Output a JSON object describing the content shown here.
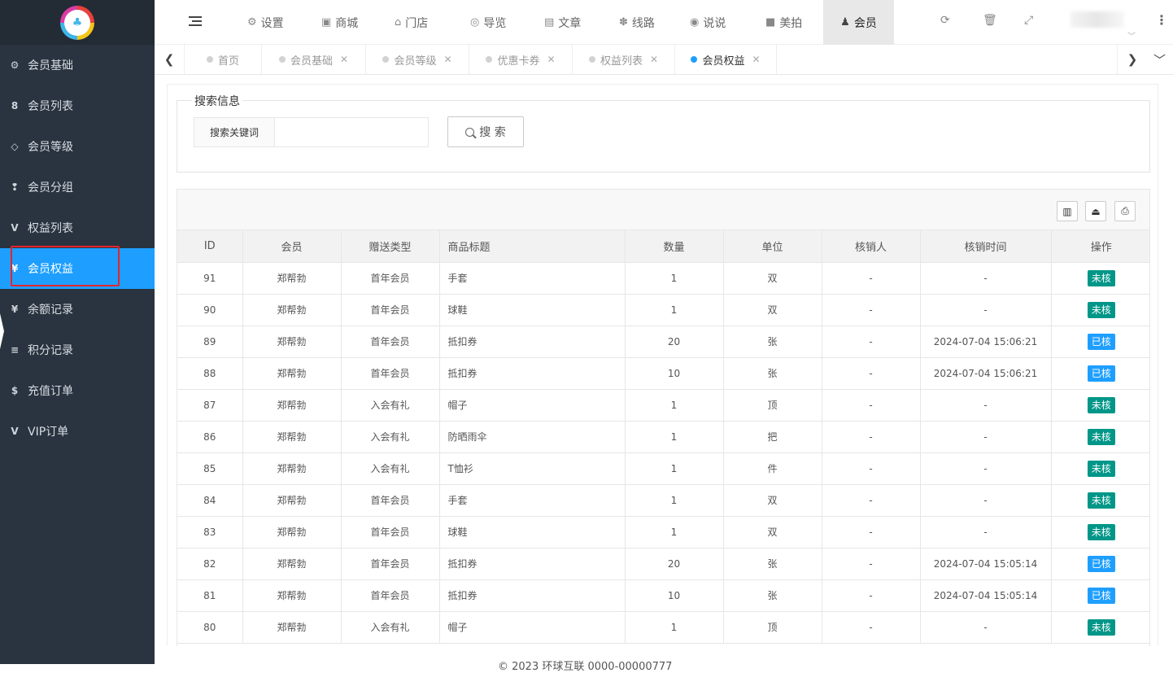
{
  "sidebar": {
    "items": [
      {
        "label": "会员基础",
        "icon": "gears-icon",
        "glyph": "⚙"
      },
      {
        "label": "会员列表",
        "icon": "user-icon",
        "glyph": "8"
      },
      {
        "label": "会员等级",
        "icon": "diamond-icon",
        "glyph": "◇"
      },
      {
        "label": "会员分组",
        "icon": "users-icon",
        "glyph": "❢"
      },
      {
        "label": "权益列表",
        "icon": "vimeo-icon",
        "glyph": "V"
      },
      {
        "label": "会员权益",
        "icon": "yen-icon",
        "glyph": "¥"
      },
      {
        "label": "余额记录",
        "icon": "yen-icon",
        "glyph": "¥"
      },
      {
        "label": "积分记录",
        "icon": "database-icon",
        "glyph": "≡"
      },
      {
        "label": "充值订单",
        "icon": "dollar-icon",
        "glyph": "$"
      },
      {
        "label": "VIP订单",
        "icon": "vimeo-icon",
        "glyph": "V"
      }
    ]
  },
  "header": {
    "nav": [
      {
        "label": "设置",
        "icon": "cogs-icon",
        "glyph": "⚙"
      },
      {
        "label": "商城",
        "icon": "shopping-bag-icon",
        "glyph": "▣"
      },
      {
        "label": "门店",
        "icon": "bank-icon",
        "glyph": "⌂"
      },
      {
        "label": "导览",
        "icon": "compass-icon",
        "glyph": "◎"
      },
      {
        "label": "文章",
        "icon": "newspaper-icon",
        "glyph": "▤"
      },
      {
        "label": "线路",
        "icon": "pagelines-icon",
        "glyph": "✽"
      },
      {
        "label": "说说",
        "icon": "wechat-icon",
        "glyph": "◉"
      },
      {
        "label": "美拍",
        "icon": "video-camera-icon",
        "glyph": "■"
      },
      {
        "label": "会员",
        "icon": "user-secret-icon",
        "glyph": "♟"
      }
    ]
  },
  "tabs": [
    {
      "label": "首页",
      "closable": false
    },
    {
      "label": "会员基础",
      "closable": true
    },
    {
      "label": "会员等级",
      "closable": true
    },
    {
      "label": "优惠卡券",
      "closable": true
    },
    {
      "label": "权益列表",
      "closable": true
    },
    {
      "label": "会员权益",
      "closable": true
    }
  ],
  "search": {
    "legend": "搜索信息",
    "keyword_label": "搜索关键词",
    "keyword_value": "",
    "button_label": "搜 索"
  },
  "table": {
    "columns": [
      "ID",
      "会员",
      "赠送类型",
      "商品标题",
      "数量",
      "单位",
      "核销人",
      "核销时间",
      "操作"
    ],
    "rows": [
      [
        "91",
        "郑帮勃",
        "首年会员",
        "手套",
        "1",
        "双",
        "-",
        "-",
        "未核"
      ],
      [
        "90",
        "郑帮勃",
        "首年会员",
        "球鞋",
        "1",
        "双",
        "-",
        "-",
        "未核"
      ],
      [
        "89",
        "郑帮勃",
        "首年会员",
        "抵扣券",
        "20",
        "张",
        "-",
        "2024-07-04 15:06:21",
        "已核"
      ],
      [
        "88",
        "郑帮勃",
        "首年会员",
        "抵扣券",
        "10",
        "张",
        "-",
        "2024-07-04 15:06:21",
        "已核"
      ],
      [
        "87",
        "郑帮勃",
        "入会有礼",
        "帽子",
        "1",
        "顶",
        "-",
        "-",
        "未核"
      ],
      [
        "86",
        "郑帮勃",
        "入会有礼",
        "防晒雨伞",
        "1",
        "把",
        "-",
        "-",
        "未核"
      ],
      [
        "85",
        "郑帮勃",
        "入会有礼",
        "T恤衫",
        "1",
        "件",
        "-",
        "-",
        "未核"
      ],
      [
        "84",
        "郑帮勃",
        "首年会员",
        "手套",
        "1",
        "双",
        "-",
        "-",
        "未核"
      ],
      [
        "83",
        "郑帮勃",
        "首年会员",
        "球鞋",
        "1",
        "双",
        "-",
        "-",
        "未核"
      ],
      [
        "82",
        "郑帮勃",
        "首年会员",
        "抵扣券",
        "20",
        "张",
        "-",
        "2024-07-04 15:05:14",
        "已核"
      ],
      [
        "81",
        "郑帮勃",
        "首年会员",
        "抵扣券",
        "10",
        "张",
        "-",
        "2024-07-04 15:05:14",
        "已核"
      ],
      [
        "80",
        "郑帮勃",
        "入会有礼",
        "帽子",
        "1",
        "顶",
        "-",
        "-",
        "未核"
      ]
    ]
  },
  "footer": {
    "text": "© 2023 环球互联 0000-00000777"
  },
  "colors": {
    "sidebar_bg": "#2a3440",
    "active_blue": "#1e9fff",
    "pending_green": "#009688",
    "highlight_red": "#e5242b"
  }
}
